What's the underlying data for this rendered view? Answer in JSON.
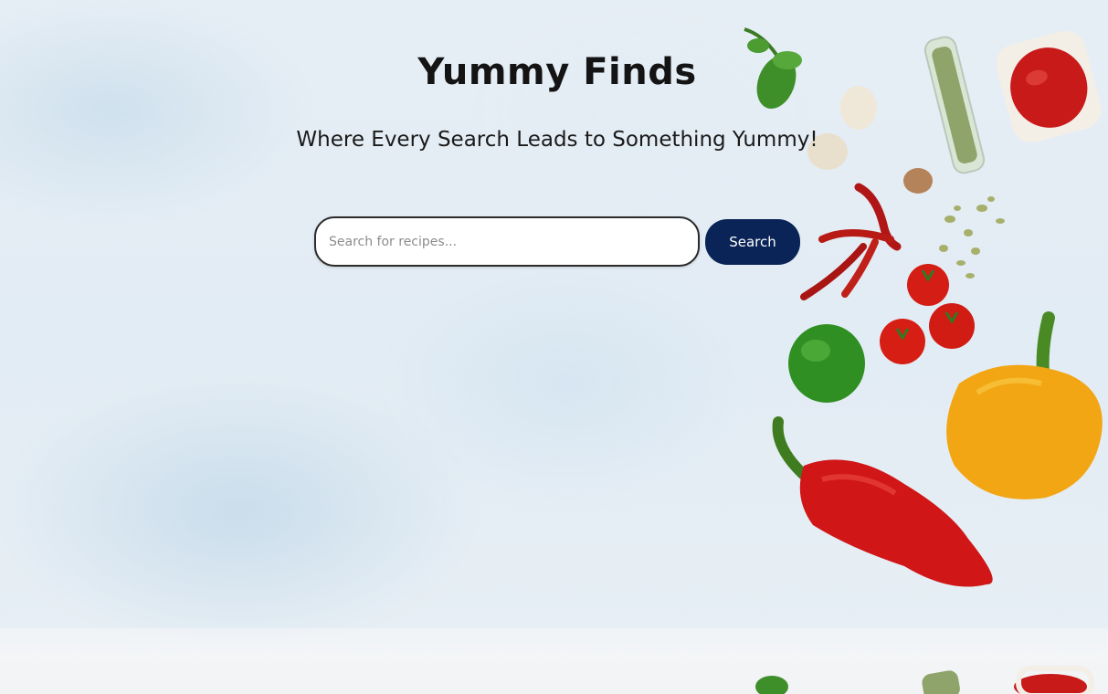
{
  "header": {
    "title": "Yummy Finds",
    "subtitle": "Where Every Search Leads to Something Yummy!"
  },
  "search": {
    "placeholder": "Search for recipes...",
    "value": "",
    "button_label": "Search"
  },
  "colors": {
    "button_bg": "#0b2457",
    "title_text": "#141414",
    "background": "#e4edf4"
  },
  "decor": {
    "items": [
      "basil",
      "garlic",
      "glass-spice-tube",
      "ketchup-bowl",
      "red-chilies",
      "seeds",
      "cherry-tomatoes",
      "lime",
      "yellow-bell-pepper",
      "red-bell-pepper"
    ]
  }
}
